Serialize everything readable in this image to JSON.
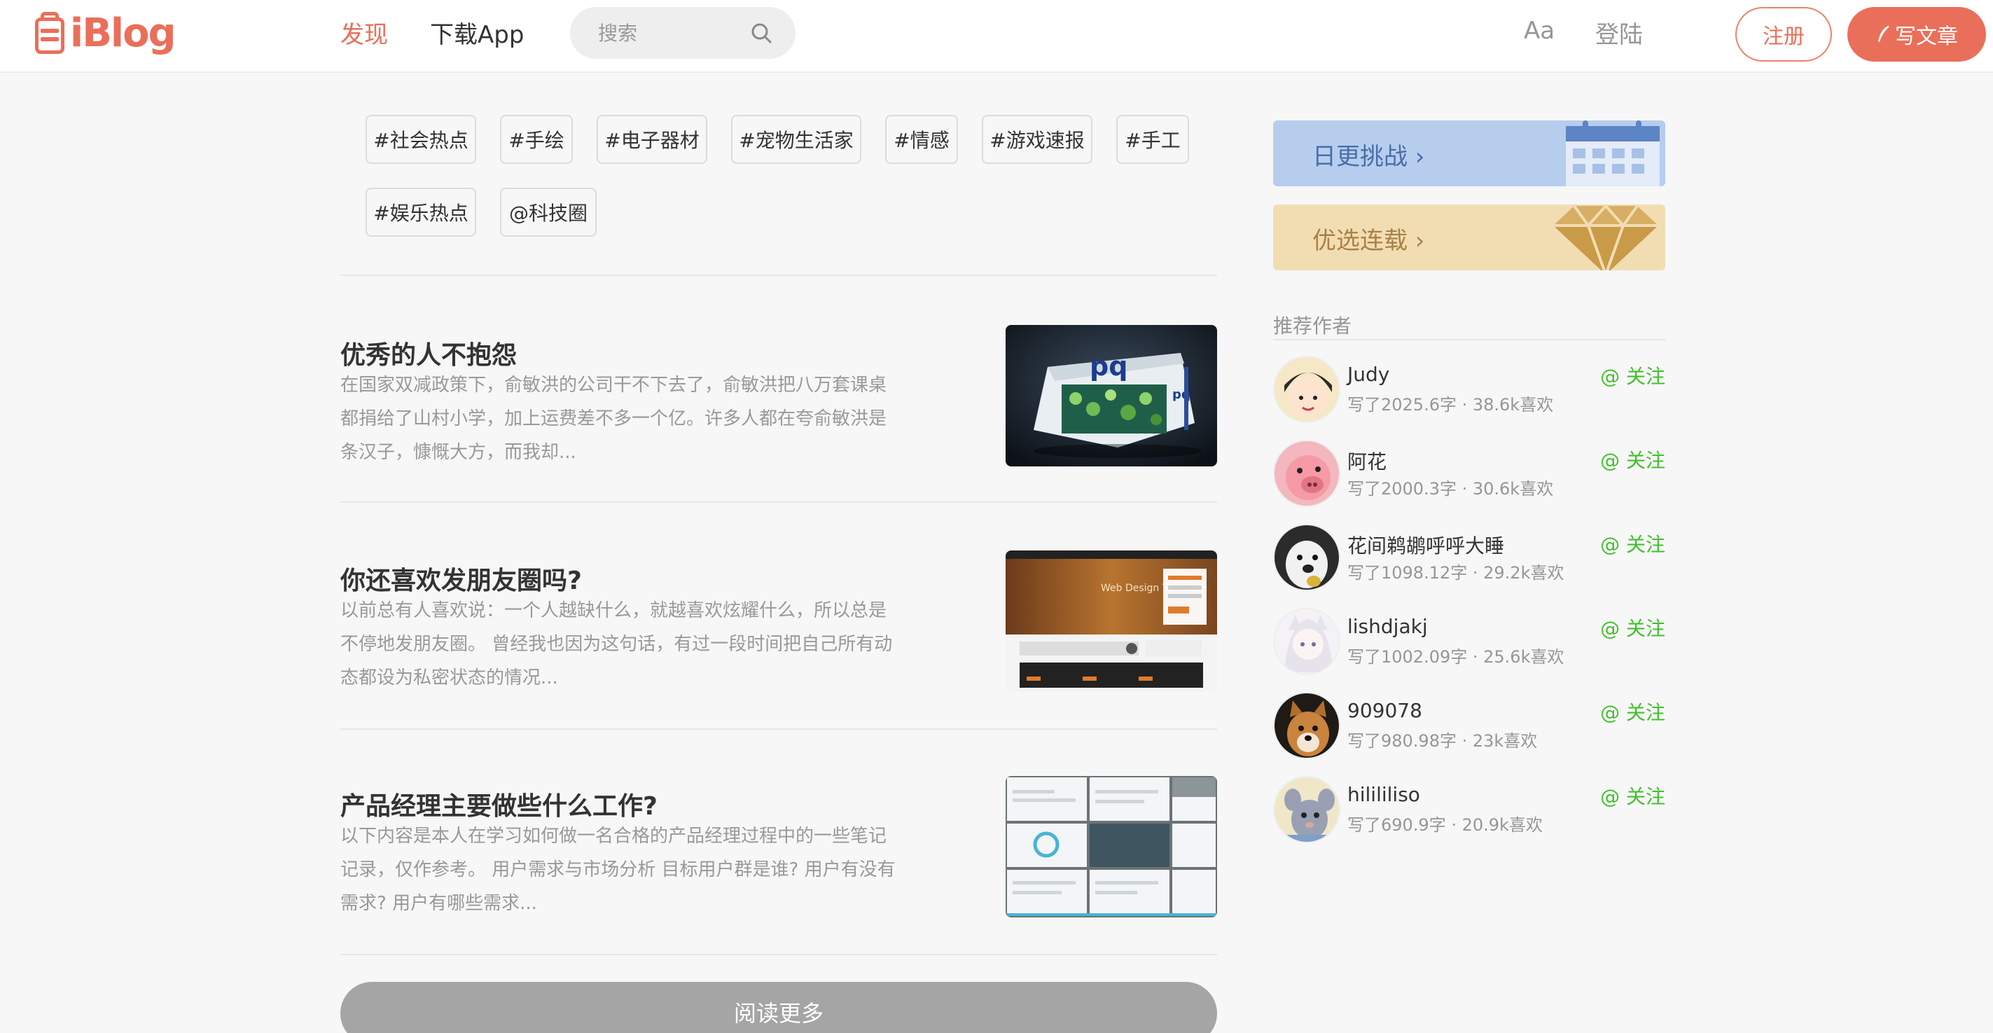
{
  "header": {
    "logo_text": "iBlog",
    "nav_discover": "发现",
    "nav_download": "下载App",
    "search_placeholder": "搜索",
    "font_toggle": "Aa",
    "login": "登陆",
    "register": "注册",
    "write": "写文章"
  },
  "tags": [
    "#社会热点",
    "#手绘",
    "#电子器材",
    "#宠物生活家",
    "#情感",
    "#游戏速报",
    "#手工",
    "#娱乐热点",
    "@科技圈"
  ],
  "articles": [
    {
      "title": "优秀的人不抱怨",
      "abstract": "在国家双减政策下，俞敏洪的公司干不下去了，俞敏洪把八万套课桌都捐给了山村小学，加上运费差不多一个亿。许多人都在夸俞敏洪是条汉子，慷慨大方，而我却...",
      "thumb": "exhibition-booth-image"
    },
    {
      "title": "你还喜欢发朋友圈吗?",
      "abstract": "以前总有人喜欢说：一个人越缺什么，就越喜欢炫耀什么，所以总是不停地发朋友圈。 曾经我也因为这句话，有过一段时间把自己所有动态都设为私密状态的情况...",
      "thumb": "web-design-template-image",
      "thumb_text": "Web Design Template"
    },
    {
      "title": "产品经理主要做些什么工作?",
      "abstract": "以下内容是本人在学习如何做一名合格的产品经理过程中的一些笔记记录，仅作参考。 用户需求与市场分析 目标用户群是谁? 用户有没有需求? 用户有哪些需求...",
      "thumb": "prototype-screens-image"
    }
  ],
  "read_more": "阅读更多",
  "sidebar": {
    "boards": [
      {
        "label": "日更挑战 ›",
        "icon": "calendar-icon",
        "color": "#b6cdee"
      },
      {
        "label": "优选连载 ›",
        "icon": "diamond-icon",
        "color": "#f2ddb2"
      }
    ],
    "recommend_title": "推荐作者",
    "follow_label": "@ 关注",
    "authors": [
      {
        "name": "Judy",
        "info": "写了2025.6字 · 38.6k喜欢"
      },
      {
        "name": "阿花",
        "info": "写了2000.3字 · 30.6k喜欢"
      },
      {
        "name": "花间鹈鹕呼呼大睡",
        "info": "写了1098.12字 · 29.2k喜欢"
      },
      {
        "name": "lishdjakj",
        "info": "写了1002.09字 · 25.6k喜欢"
      },
      {
        "name": "909078",
        "info": "写了980.98字 · 23k喜欢"
      },
      {
        "name": "hilililiso",
        "info": "写了690.9字 · 20.9k喜欢"
      }
    ]
  },
  "colors": {
    "brand": "#ea6f5a",
    "follow": "#42c02e",
    "muted": "#969696"
  }
}
